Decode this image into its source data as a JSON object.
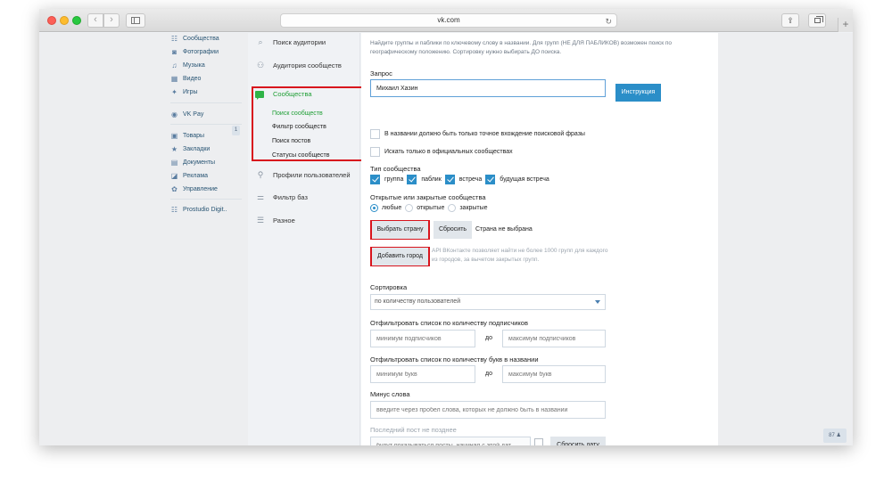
{
  "browser": {
    "url": "vk.com",
    "new_tab": "+",
    "back": "‹",
    "forward": "›",
    "share": "⇪",
    "reload": "↻"
  },
  "vk_menu": {
    "items": [
      {
        "label": "Сообщества",
        "icon": "groups-icon",
        "glyph": "☷"
      },
      {
        "label": "Фотографии",
        "icon": "photo-icon",
        "glyph": "◙"
      },
      {
        "label": "Музыка",
        "icon": "music-icon",
        "glyph": "♫"
      },
      {
        "label": "Видео",
        "icon": "video-icon",
        "glyph": "▦"
      },
      {
        "label": "Игры",
        "icon": "games-icon",
        "glyph": "✦"
      },
      {
        "label": "VK Pay",
        "icon": "vkpay-icon",
        "glyph": "◉"
      },
      {
        "label": "Товары",
        "icon": "goods-icon",
        "glyph": "▣"
      },
      {
        "label": "Закладки",
        "icon": "star-icon",
        "glyph": "★"
      },
      {
        "label": "Документы",
        "icon": "docs-icon",
        "glyph": "▤"
      },
      {
        "label": "Реклама",
        "icon": "ads-icon",
        "glyph": "◪"
      },
      {
        "label": "Управление",
        "icon": "manage-icon",
        "glyph": "✿"
      },
      {
        "label": "Prostudio Digit..",
        "icon": "community-icon",
        "glyph": "☷"
      }
    ],
    "goods_badge": "1"
  },
  "tool_menu": {
    "items": [
      {
        "label": "Поиск аудитории",
        "glyph": "⌕"
      },
      {
        "label": "Аудитория сообществ",
        "glyph": "⚇"
      },
      {
        "label": "Профили пользователей",
        "glyph": "⚲"
      },
      {
        "label": "Фильтр баз",
        "glyph": "⚌"
      },
      {
        "label": "Разное",
        "glyph": "☰"
      }
    ],
    "section": "Сообщества",
    "sub": [
      "Поиск сообществ",
      "Фильтр сообществ",
      "Поиск постов",
      "Статусы сообществ"
    ]
  },
  "form": {
    "info": "Найдите группы и паблики по ключевому слову в названии. Для групп (НЕ ДЛЯ ПАБЛИКОВ) возможен поиск по географическому положению. Сортировку нужно выбирать ДО поиска.",
    "query_label": "Запрос",
    "query_value": "Михаил Хазин",
    "instruction_button": "Инструкция",
    "exact_match": "В названии должно быть только точное вхождение поисковой фразы",
    "official_only": "Искать только в официальных сообществах",
    "type_label": "Тип сообщества",
    "types": [
      "группа",
      "паблик",
      "встреча",
      "будущая встреча"
    ],
    "open_closed_label": "Открытые или закрытые сообщества",
    "open_closed": [
      "любые",
      "открытые",
      "закрытые"
    ],
    "choose_country": "Выбрать страну",
    "reset": "Сбросить",
    "country_status": "Страна не выбрана",
    "add_city": "Добавить город",
    "limit_note": "API ВКонтакте позволяет найти не более 1000 групп для каждого из городов, за вычетом закрытых групп.",
    "sort_label": "Сортировка",
    "sort_value": "по количеству пользователей",
    "subs_label": "Отфильтровать список по количеству подписчиков",
    "subs_min": "минимум подписчиков",
    "subs_max": "максимум подписчиков",
    "to": "до",
    "letters_label": "Отфильтровать список по количеству букв в названии",
    "letters_min": "минимум букв",
    "letters_max": "максимум букв",
    "minus_label": "Минус слова",
    "minus_placeholder": "введите через пробел слова, которых не должно быть в названии",
    "last_post_label": "Последний пост не позднее",
    "last_post_placeholder": "будут показываться посты, начиная с этой дат...",
    "reset_date": "Сбросить дату"
  },
  "online_badge": "87 ♟",
  "colors": {
    "accent": "#2b8ec8",
    "green": "#1e9e34",
    "highlight": "#d8141d"
  }
}
